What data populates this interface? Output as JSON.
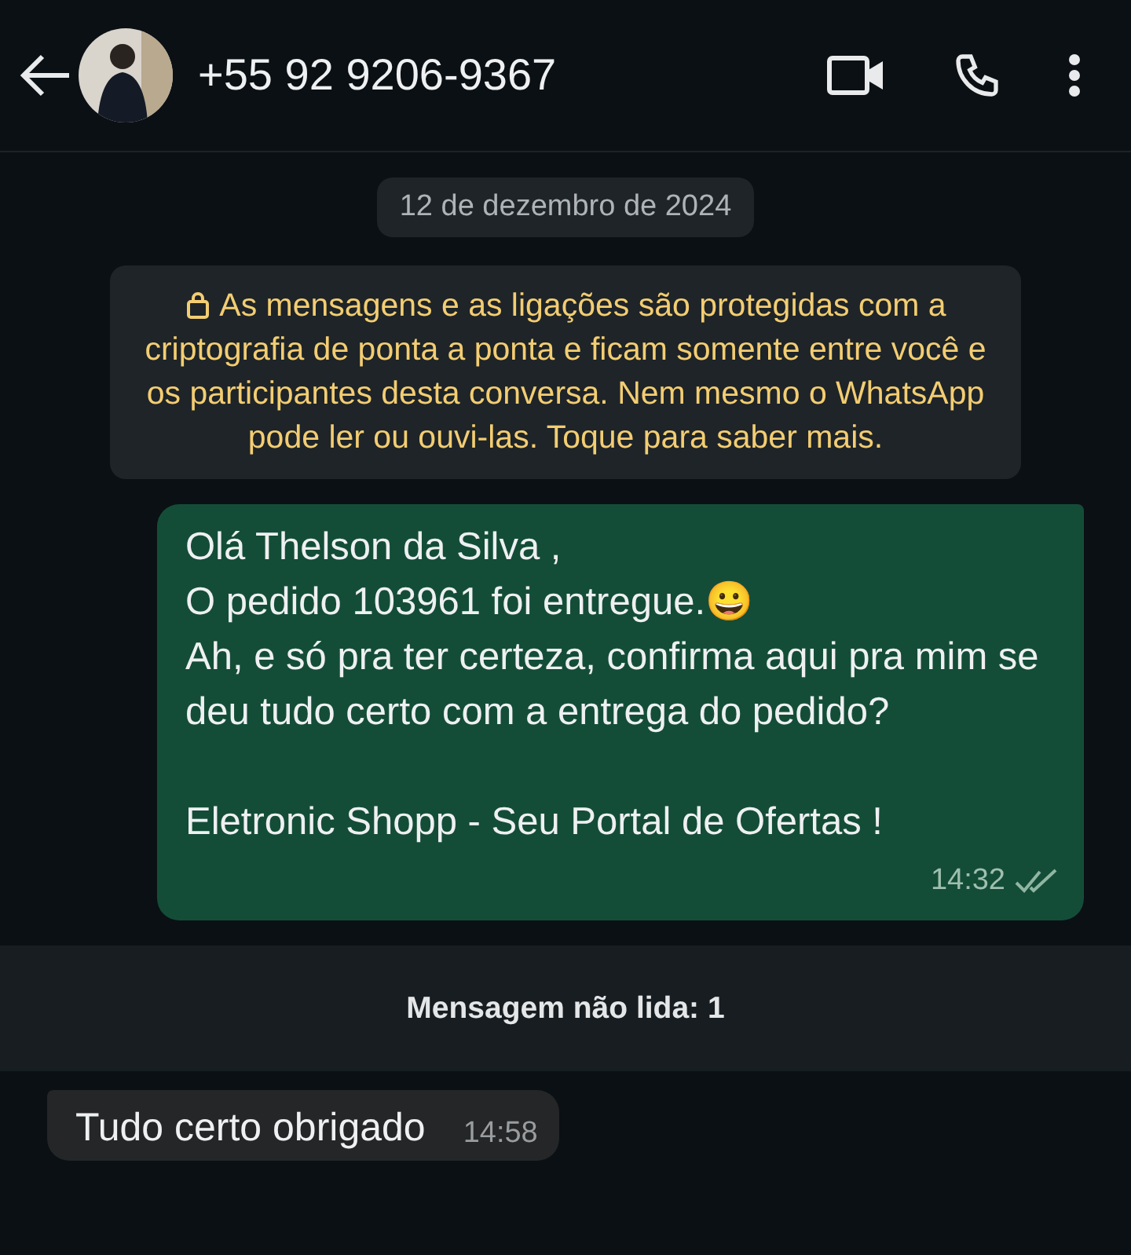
{
  "header": {
    "contact": "+55 92 9206-9367"
  },
  "date_chip": "12 de dezembro de 2024",
  "encryption_notice": "As mensagens e as ligações são protegidas com a criptografia de ponta a ponta e ficam somente entre você e os participantes desta conversa. Nem mesmo o WhatsApp pode ler ou ouvi-las. Toque para saber mais.",
  "messages": [
    {
      "kind": "outgoing",
      "lines": [
        "Olá Thelson da Silva ,",
        "O pedido 103961 foi entregue.😀",
        "Ah, e só pra ter certeza, confirma aqui pra mim se deu tudo certo com a entrega do pedido?"
      ],
      "signature": "Eletronic Shopp - Seu Portal de Ofertas !",
      "time": "14:32",
      "read": false
    },
    {
      "kind": "unread",
      "text": "Mensagem não lida: 1"
    },
    {
      "kind": "incoming",
      "lines": [
        "Tudo certo obrigado"
      ],
      "time": "14:58"
    }
  ]
}
